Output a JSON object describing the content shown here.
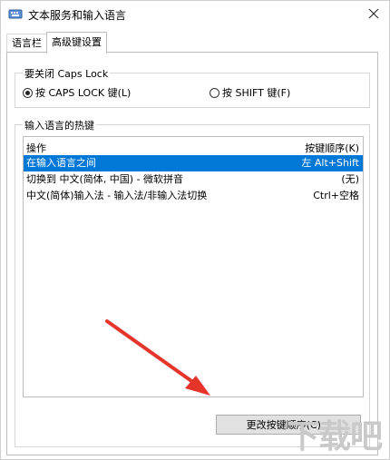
{
  "window": {
    "title": "文本服务和输入语言"
  },
  "tabs": [
    {
      "label": "语言栏"
    },
    {
      "label": "高级键设置"
    }
  ],
  "caps_lock": {
    "caption": "要关闭 Caps Lock",
    "options": [
      {
        "label": "按 CAPS LOCK 键(L)",
        "checked": true
      },
      {
        "label": "按 SHIFT 键(F)",
        "checked": false
      }
    ]
  },
  "hotkeys": {
    "caption": "输入语言的热键",
    "columns": {
      "action": "操作",
      "key_sequence": "按键顺序(K)"
    },
    "rows": [
      {
        "action": "在输入语言之间",
        "key": "左 Alt+Shift",
        "selected": true
      },
      {
        "action": "切换到 中文(简体, 中国) - 微软拼音",
        "key": "(无)",
        "selected": false
      },
      {
        "action": "中文(简体)输入法 - 输入法/非输入法切换",
        "key": "Ctrl+空格",
        "selected": false
      }
    ],
    "change_button_label": "更改按键顺序(C)..."
  },
  "watermark": {
    "text": "下载吧"
  },
  "colors": {
    "selection": "#0078d7",
    "arrow": "#e5352b"
  }
}
